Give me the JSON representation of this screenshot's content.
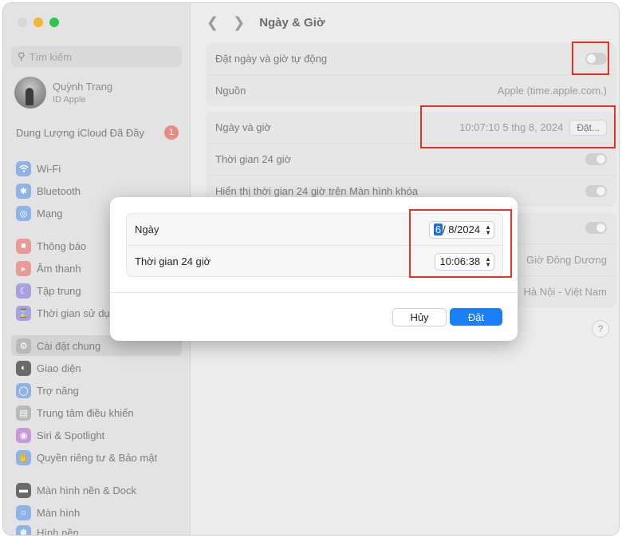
{
  "sidebar": {
    "search_placeholder": "Tìm kiếm",
    "profile": {
      "name": "Quỳnh Trang",
      "subtitle": "ID Apple"
    },
    "icloud": {
      "label": "Dung Lượng iCloud Đã Đầy",
      "badge": "1"
    },
    "items": [
      {
        "label": "Wi-Fi",
        "icon": "wifi-icon",
        "color": "#8fb3e5"
      },
      {
        "label": "Bluetooth",
        "icon": "bluetooth-icon",
        "color": "#8fb3e5"
      },
      {
        "label": "Mạng",
        "icon": "globe-icon",
        "color": "#8fb3e5"
      },
      {
        "label": "Thông báo",
        "icon": "bell-icon",
        "color": "#e99a97"
      },
      {
        "label": "Âm thanh",
        "icon": "speaker-icon",
        "color": "#e99a97"
      },
      {
        "label": "Tập trung",
        "icon": "moon-icon",
        "color": "#a8a1e0"
      },
      {
        "label": "Thời gian sử dụng",
        "icon": "hourglass-icon",
        "color": "#a8a1e0"
      },
      {
        "label": "Cài đặt chung",
        "icon": "gear-icon",
        "color": "#b9b9b9"
      },
      {
        "label": "Giao diện",
        "icon": "appearance-icon",
        "color": "#6a6a6a"
      },
      {
        "label": "Trợ năng",
        "icon": "accessibility-icon",
        "color": "#8fb3e5"
      },
      {
        "label": "Trung tâm điều khiển",
        "icon": "control-center-icon",
        "color": "#b9b9b9"
      },
      {
        "label": "Siri & Spotlight",
        "icon": "siri-icon",
        "color": "#c59ad6"
      },
      {
        "label": "Quyền riêng tư & Bảo mật",
        "icon": "hand-icon",
        "color": "#8fb3e5"
      },
      {
        "label": "Màn hình nền & Dock",
        "icon": "desktop-icon",
        "color": "#6a6a6a"
      },
      {
        "label": "Màn hình",
        "icon": "display-icon",
        "color": "#8fb3e5"
      },
      {
        "label": "Hình nền",
        "icon": "wallpaper-icon",
        "color": "#8fb3e5"
      }
    ]
  },
  "header": {
    "title": "Ngày & Giờ"
  },
  "settings": {
    "auto_set": "Đặt ngày và giờ tự động",
    "source_label": "Nguồn",
    "source_value": "Apple (time.apple.com.)",
    "datetime_label": "Ngày và giờ",
    "datetime_value": "10:07:10 5 thg 8, 2024",
    "datetime_button": "Đặt...",
    "time24_label": "Thời gian 24 giờ",
    "lockscreen_label": "Hiển thị thời gian 24 giờ trên Màn hình khóa",
    "timezone_value": "Giờ Đông Dương",
    "city_value": "Hà Nội - Việt Nam",
    "help": "?"
  },
  "dialog": {
    "date_label": "Ngày",
    "date_day": "6",
    "date_rest": "/ 8/2024",
    "time_label": "Thời gian 24 giờ",
    "time_value": "10:06:38",
    "cancel": "Hủy",
    "ok": "Đặt"
  }
}
